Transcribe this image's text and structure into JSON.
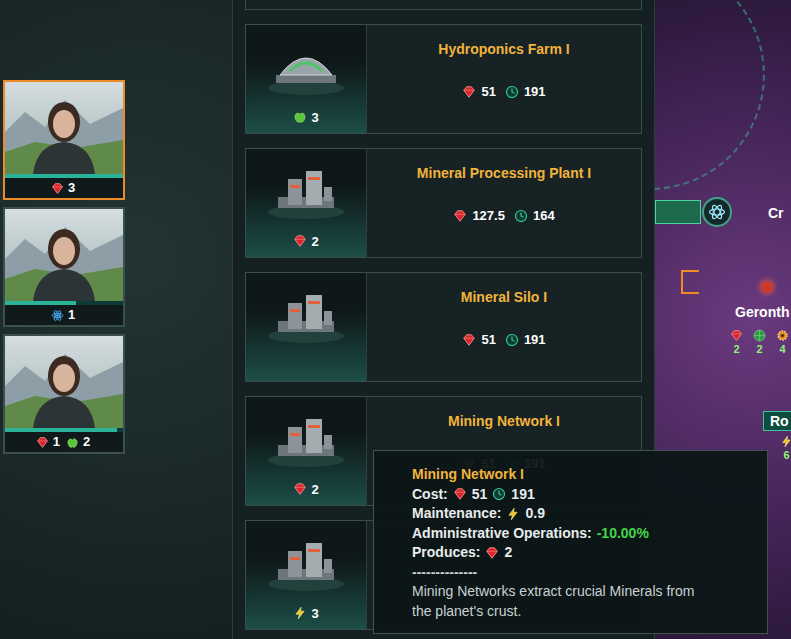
{
  "portraits": [
    {
      "selected": true,
      "level": 1,
      "outputs": [
        {
          "kind": "minerals",
          "value": "3"
        }
      ]
    },
    {
      "selected": false,
      "level": 0.6,
      "outputs": [
        {
          "kind": "research",
          "value": "1"
        }
      ]
    },
    {
      "selected": false,
      "level": 0.95,
      "outputs": [
        {
          "kind": "minerals",
          "value": "1"
        },
        {
          "kind": "food",
          "value": "2"
        }
      ]
    }
  ],
  "buildings": [
    {
      "name": "Hydroponics Farm I",
      "cost": "51",
      "time": "191",
      "produces": {
        "kind": "food",
        "value": "3"
      }
    },
    {
      "name": "Mineral Processing Plant I",
      "cost": "127.5",
      "time": "164",
      "produces": {
        "kind": "minerals",
        "value": "2"
      }
    },
    {
      "name": "Mineral Silo I",
      "cost": "51",
      "time": "191"
    },
    {
      "name": "Mining Network I",
      "cost": "51",
      "time": "191",
      "produces": {
        "kind": "minerals",
        "value": "2"
      }
    },
    {
      "produces": {
        "kind": "energy",
        "value": "3"
      }
    }
  ],
  "tooltip": {
    "title": "Mining Network I",
    "rows": [
      {
        "label": "Cost:",
        "values": [
          {
            "kind": "minerals",
            "value": "51"
          },
          {
            "kind": "time",
            "value": "191"
          }
        ]
      },
      {
        "label": "Maintenance:",
        "values": [
          {
            "kind": "energy",
            "value": "0.9"
          }
        ]
      },
      {
        "label": "Administrative Operations:",
        "values": [
          {
            "kind": "positive",
            "value": "-10.00%"
          }
        ]
      },
      {
        "label": "Produces:",
        "values": [
          {
            "kind": "minerals",
            "value": "2"
          }
        ]
      }
    ],
    "separator": "--------------",
    "description": "Mining Networks extract crucial Minerals from the planet's crust."
  },
  "map": {
    "systems": [
      {
        "name": "Cr",
        "stats": []
      },
      {
        "name": "Geronth",
        "stats": [
          {
            "kind": "minerals",
            "value": "2"
          },
          {
            "kind": "planet",
            "value": "2"
          },
          {
            "kind": "alloys",
            "value": "4"
          }
        ]
      },
      {
        "name": "Ro",
        "stats": [
          {
            "kind": "energy",
            "value": "6"
          }
        ]
      }
    ]
  }
}
